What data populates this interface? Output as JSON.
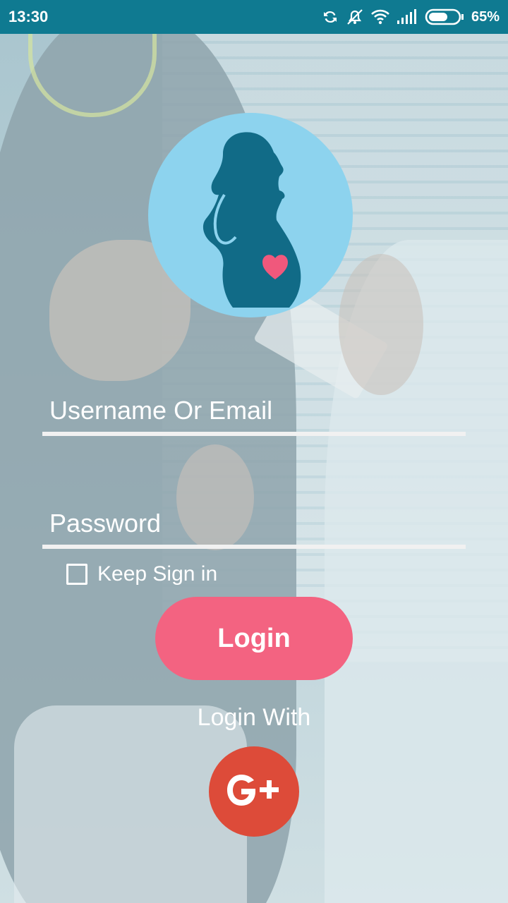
{
  "status_bar": {
    "time": "13:30",
    "battery_percent": "65%",
    "battery_level": 0.65,
    "icons": [
      "sync-icon",
      "mute-icon",
      "wifi-icon",
      "signal-icon",
      "battery-icon"
    ],
    "background": "#0f7a91"
  },
  "logo": {
    "icon": "pregnant-woman-heart-icon",
    "circle_color": "#8dd3ee",
    "silhouette_color": "#116b87",
    "heart_color": "#f0587c"
  },
  "form": {
    "username_placeholder": "Username Or Email",
    "password_placeholder": "Password",
    "keep_signed_in_label": "Keep Sign in",
    "keep_signed_in_checked": false,
    "login_label": "Login",
    "login_with_label": "Login With",
    "google_plus_icon": "google-plus-icon"
  },
  "colors": {
    "accent": "#f36381",
    "google": "#dd4b39"
  }
}
